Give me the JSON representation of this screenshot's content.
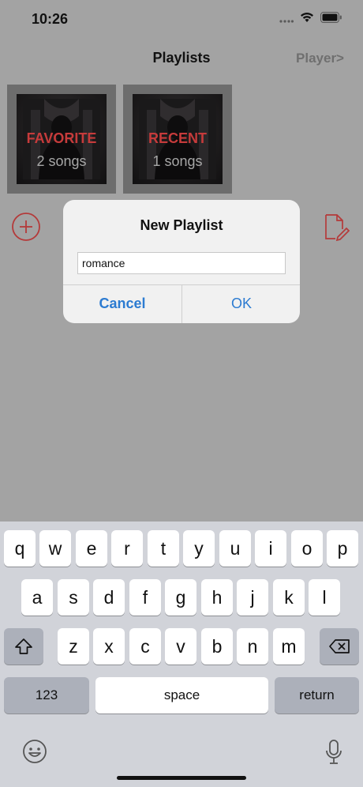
{
  "status_bar": {
    "time": "10:26"
  },
  "nav": {
    "title": "Playlists",
    "right_button": "Player>"
  },
  "playlists": [
    {
      "name": "FAVORITE",
      "count": "2 songs"
    },
    {
      "name": "RECENT",
      "count": "1 songs"
    }
  ],
  "icons": {
    "add": "add-circle-icon",
    "edit": "edit-document-icon"
  },
  "dialog": {
    "title": "New Playlist",
    "input_value": "romance",
    "cancel_label": "Cancel",
    "ok_label": "OK"
  },
  "keyboard": {
    "row1": [
      "q",
      "w",
      "e",
      "r",
      "t",
      "y",
      "u",
      "i",
      "o",
      "p"
    ],
    "row2": [
      "a",
      "s",
      "d",
      "f",
      "g",
      "h",
      "j",
      "k",
      "l"
    ],
    "row3": [
      "z",
      "x",
      "c",
      "v",
      "b",
      "n",
      "m"
    ],
    "numbers_label": "123",
    "space_label": "space",
    "return_label": "return"
  },
  "colors": {
    "accent_red": "#c63b3b",
    "dialog_blue": "#2c7bd1"
  }
}
